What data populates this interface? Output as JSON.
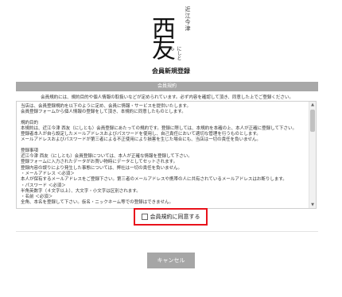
{
  "logo": {
    "small_text": "近江今津",
    "main_text": "西友",
    "kana": "にしとも"
  },
  "page_title": "会員新規登録",
  "terms_section": {
    "header": "会員規約",
    "notice": "会員規約には、規約目的や個人情報の取扱いなどが定められています。必ず内容を確認して頂き、同意した上でご登録ください。",
    "lines": [
      "当店は、会員登録規約を以下のように定め、会員に情報・サービスを提供いたします。",
      "会員登録フォームから個人情報の登録をして頂き、本規約に同意したものとします。",
      "",
      "規約目的",
      "本規約は、近江今津 西友（にしとも）会員登録にあたっての規約です。登録に際しては、本規約を本確の上、本人が正確に登録して下さい。",
      "登録者本人が自ら設定したメールアドレスおよびパスワードを使用し、自己責任において適切な管理を行うものとします。",
      "メールアドレスおよびパスワードが第三者による不正使用により損害を生じた場合にも、当店は一切の責任を負いません。",
      "",
      "登録事項",
      "近江今津 西友（にしとも）会員登録については、本人が正確な情報を登録して下さい。",
      "登録フォームに入力されたデータがお買い物時にデータとしてセットされます。",
      "登録内容の誤りにより発生した事態については、弊社は一切の責任を負いません。",
      "・メールアドレス ＜必須＞",
      "本人が保有するメールアドレスをご登録下さい。第三者のメールアドレスや携帯の人に共有されているメールアドレスはお断りします。",
      "・パスワード ＜必須＞",
      "半角英数字（４文字以上）、大文字・小文字は区別されます。",
      "・名前 ＜必須＞",
      "全角、本名を登録して下さい。仮名・ニックネーム等での登録はできません。"
    ]
  },
  "agree_label": "会員規約に同意する",
  "cancel_label": "キャンセル"
}
